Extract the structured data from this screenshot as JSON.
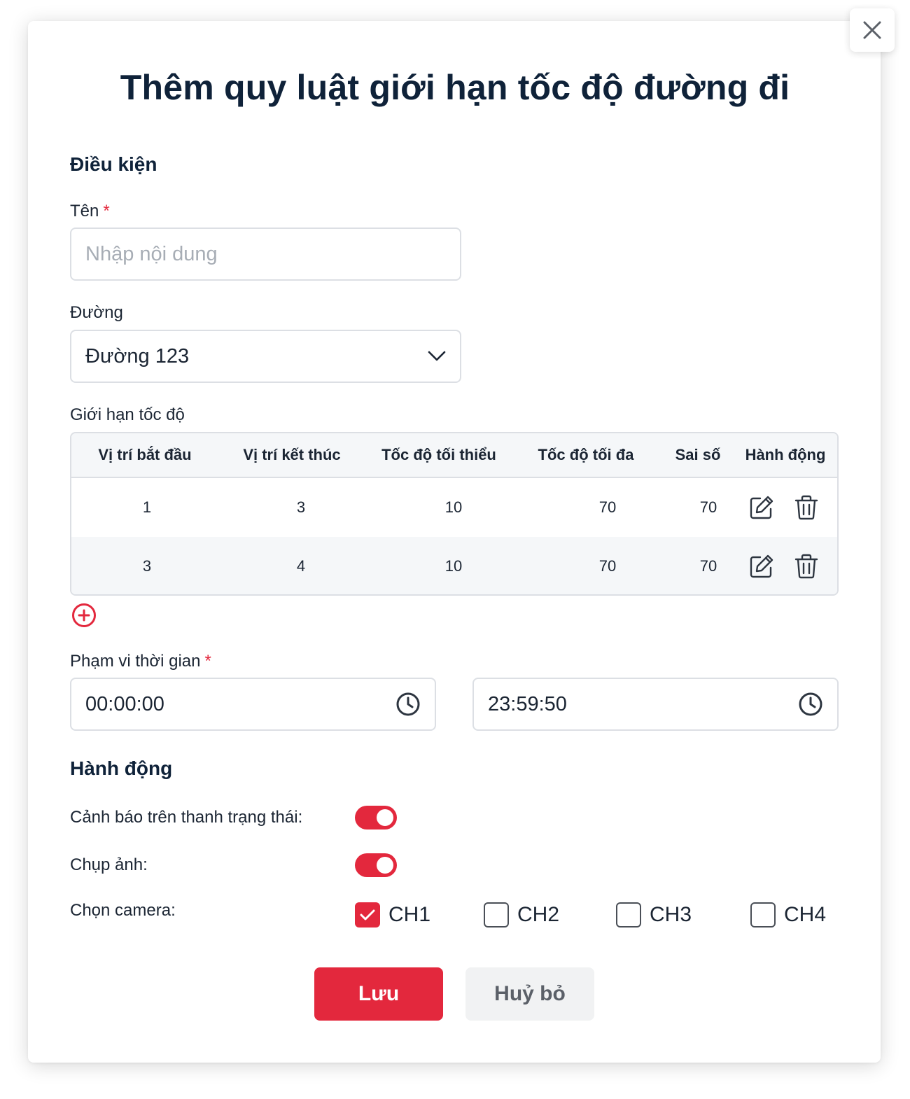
{
  "title": "Thêm quy luật giới hạn tốc độ đường đi",
  "conditions": {
    "heading": "Điều kiện",
    "name": {
      "label": "Tên",
      "required": "*",
      "value": "",
      "placeholder": "Nhập nội dung"
    },
    "road": {
      "label": "Đường",
      "value": "Đường 123"
    },
    "speed_limit": {
      "label": "Giới hạn tốc độ",
      "columns": [
        "Vị trí bắt đầu",
        "Vị trí kết thúc",
        "Tốc độ tối thiểu",
        "Tốc độ tối đa",
        "Sai số",
        "Hành động"
      ],
      "rows": [
        {
          "start": "1",
          "end": "3",
          "min": "10",
          "max": "70",
          "tolerance": "70"
        },
        {
          "start": "3",
          "end": "4",
          "min": "10",
          "max": "70",
          "tolerance": "70"
        }
      ]
    },
    "time_range": {
      "label": "Phạm vi thời gian",
      "required": "*",
      "from": "00:00:00",
      "to": "23:59:50"
    }
  },
  "actions": {
    "heading": "Hành động",
    "status_bar_alert": {
      "label": "Cảnh báo trên thanh trạng thái:",
      "on": true
    },
    "capture": {
      "label": "Chụp ảnh:",
      "on": true
    },
    "camera": {
      "label": "Chọn camera:",
      "options": [
        {
          "label": "CH1",
          "checked": true
        },
        {
          "label": "CH2",
          "checked": false
        },
        {
          "label": "CH3",
          "checked": false
        },
        {
          "label": "CH4",
          "checked": false
        }
      ]
    }
  },
  "buttons": {
    "save": "Lưu",
    "cancel": "Huỷ bỏ"
  },
  "colors": {
    "accent": "#e3283d",
    "title": "#0f2239",
    "border": "#dcdfe4",
    "row_alt": "#f5f7f9"
  }
}
